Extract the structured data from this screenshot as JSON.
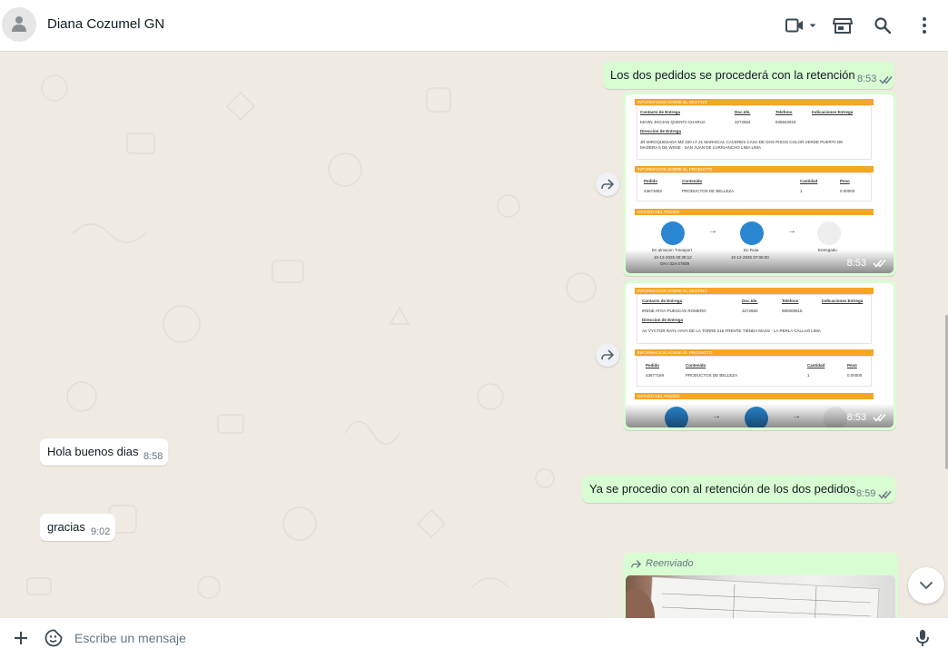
{
  "header": {
    "contact_name": "Diana Cozumel GN",
    "icons": [
      "person-icon",
      "video-call-icon",
      "chevron-down-icon",
      "catalog-icon",
      "search-icon",
      "more-vertical-icon"
    ]
  },
  "messages": {
    "m1": {
      "text": "Los dos pedidos se procederá con la retención",
      "time": "8:53"
    },
    "img1": {
      "time": "8:53",
      "s1": "INFORMACION SOBRE EL DESTINO",
      "h_contacto": "Contacto de Entrega",
      "h_doc": "Doc.Ide.",
      "h_tel": "Telefono",
      "h_ind": "Indicaciones Entrega",
      "contacto": "KEVIN JHOJAN QUENTA CHARUA",
      "doc": "3272664",
      "tel": "935842915",
      "h_dir": "Direccion de Entrega",
      "dir1": "JR MIROQUESADA MZ 220 LT 21 MARISCAL CACERES CASA DE DOS PISOS COLOR VERDE PUERTA DE",
      "dir2": "MADERA 5 DE WSSE - SAN JUAN DE LURIGANCHO LIMA LIMA",
      "s2": "INFORMACION SOBRE EL PRODUCTO",
      "h_pedido": "Pedido",
      "h_contenido": "Contenido",
      "h_cantidad": "Cantidad",
      "h_peso": "Peso",
      "pedido": "43673082",
      "contenido": "PRODUCTOS DE BELLEZA",
      "cantidad": "1",
      "peso": "0.00000",
      "s3": "ESTADO DEL PEDIDO",
      "st1": "En almacen Transport",
      "st1d": "10-12-2025 00:38:12",
      "st1c": "OH / 024-27609",
      "st2": "En Ruta",
      "st2d": "10-12-2025 07:06:00",
      "st3": "Entregado"
    },
    "img2": {
      "time": "8:53",
      "s1": "INFORMACION SOBRE EL DESTINO",
      "h_contacto": "Contacto de Entrega",
      "h_doc": "Doc.Ide.",
      "h_tel": "Telefono",
      "h_ind": "Indicaciones Entrega",
      "contacto": "IRENE ATOA PUESCAS ROMERO",
      "doc": "3272650",
      "tel": "980008915",
      "h_dir": "Direccion de Entrega",
      "dir1": "AV VYCTOR RAYL HAYA DE LA TORRE 216 FRENTE TIENDA MASS - LA PERLA CALLAO LIMA",
      "s2": "INFORMACION SOBRE EL PRODUCTO",
      "h_pedido": "Pedido",
      "h_contenido": "Contenido",
      "h_cantidad": "Cantidad",
      "h_peso": "Peso",
      "pedido": "43677169",
      "contenido": "PRODUCTOS DE BELLEZA",
      "cantidad": "1",
      "peso": "0.00000",
      "s3": "ESTADO DEL PEDIDO"
    },
    "m2": {
      "text": "Hola buenos dias",
      "time": "8:58"
    },
    "m3": {
      "text": "Ya se procedio con al retención de los dos pedidos",
      "time": "8:59"
    },
    "m4": {
      "text": "gracias",
      "time": "9:02"
    },
    "m5": {
      "forwarded_label": "Reenviado"
    }
  },
  "composer": {
    "placeholder": "Escribe un mensaje",
    "icons": [
      "plus-icon",
      "sticker-icon",
      "microphone-icon"
    ]
  },
  "colors": {
    "outgoing_bubble": "#d9fdd3",
    "incoming_bubble": "#ffffff",
    "chat_background": "#efeae2",
    "read_tick": "#53bdeb",
    "doc_accent": "#f5a623",
    "status_blue": "#2a86d1"
  }
}
